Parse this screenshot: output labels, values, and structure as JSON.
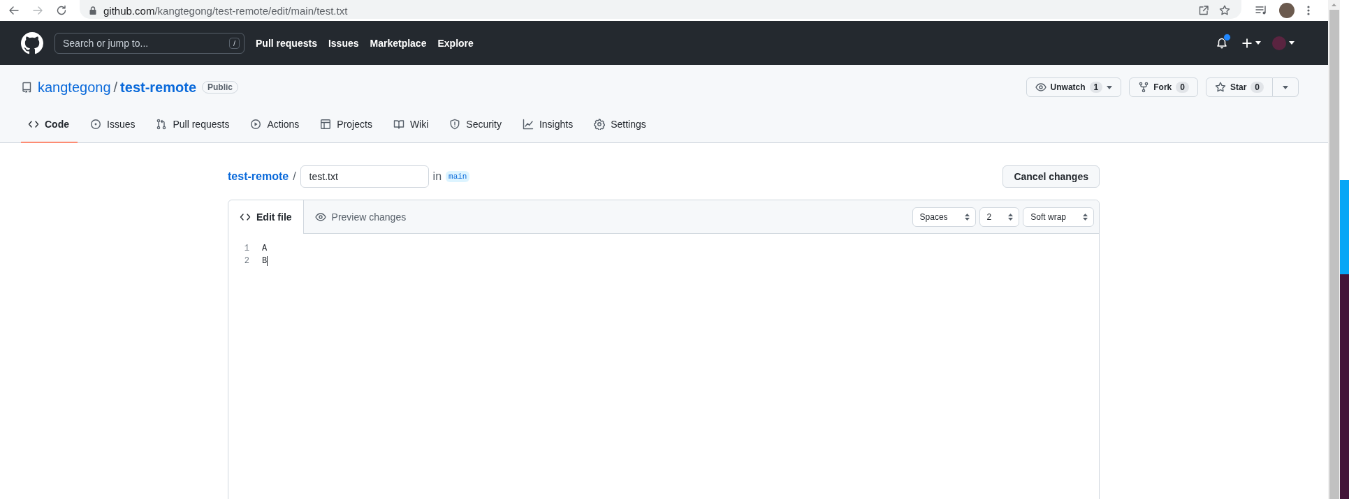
{
  "browser": {
    "url_host": "github.com",
    "url_path": "/kangtegong/test-remote/edit/main/test.txt"
  },
  "header": {
    "search_placeholder": "Search or jump to...",
    "search_shortcut": "/",
    "nav": [
      "Pull requests",
      "Issues",
      "Marketplace",
      "Explore"
    ],
    "notifications_unread": true
  },
  "repo": {
    "owner": "kangtegong",
    "separator": "/",
    "name": "test-remote",
    "visibility": "Public",
    "actions": [
      {
        "kind": "watch",
        "label": "Unwatch",
        "count": "1",
        "dropdown": true,
        "split": false
      },
      {
        "kind": "fork",
        "label": "Fork",
        "count": "0"
      },
      {
        "kind": "star",
        "label": "Star",
        "count": "0",
        "dropdown": true,
        "split": true
      }
    ]
  },
  "tabs": [
    {
      "kind": "code",
      "label": "Code",
      "selected": true
    },
    {
      "kind": "issues",
      "label": "Issues",
      "selected": false
    },
    {
      "kind": "pulls",
      "label": "Pull requests",
      "selected": false
    },
    {
      "kind": "actions",
      "label": "Actions",
      "selected": false
    },
    {
      "kind": "projects",
      "label": "Projects",
      "selected": false
    },
    {
      "kind": "wiki",
      "label": "Wiki",
      "selected": false
    },
    {
      "kind": "security",
      "label": "Security",
      "selected": false
    },
    {
      "kind": "insights",
      "label": "Insights",
      "selected": false
    },
    {
      "kind": "settings",
      "label": "Settings",
      "selected": false
    }
  ],
  "editor": {
    "root": "test-remote",
    "separator": "/",
    "filename": "test.txt",
    "branch_prefix": "in",
    "branch": "main",
    "cancel_button": "Cancel changes",
    "tabs": [
      {
        "kind": "code",
        "label": "Edit file",
        "selected": true
      },
      {
        "kind": "eye",
        "label": "Preview changes",
        "selected": false
      }
    ],
    "selects": [
      "Spaces",
      "2",
      "Soft wrap"
    ],
    "lines": [
      {
        "number": "1",
        "text": "A",
        "cursor": false
      },
      {
        "number": "2",
        "text": "B",
        "cursor": true
      }
    ]
  }
}
